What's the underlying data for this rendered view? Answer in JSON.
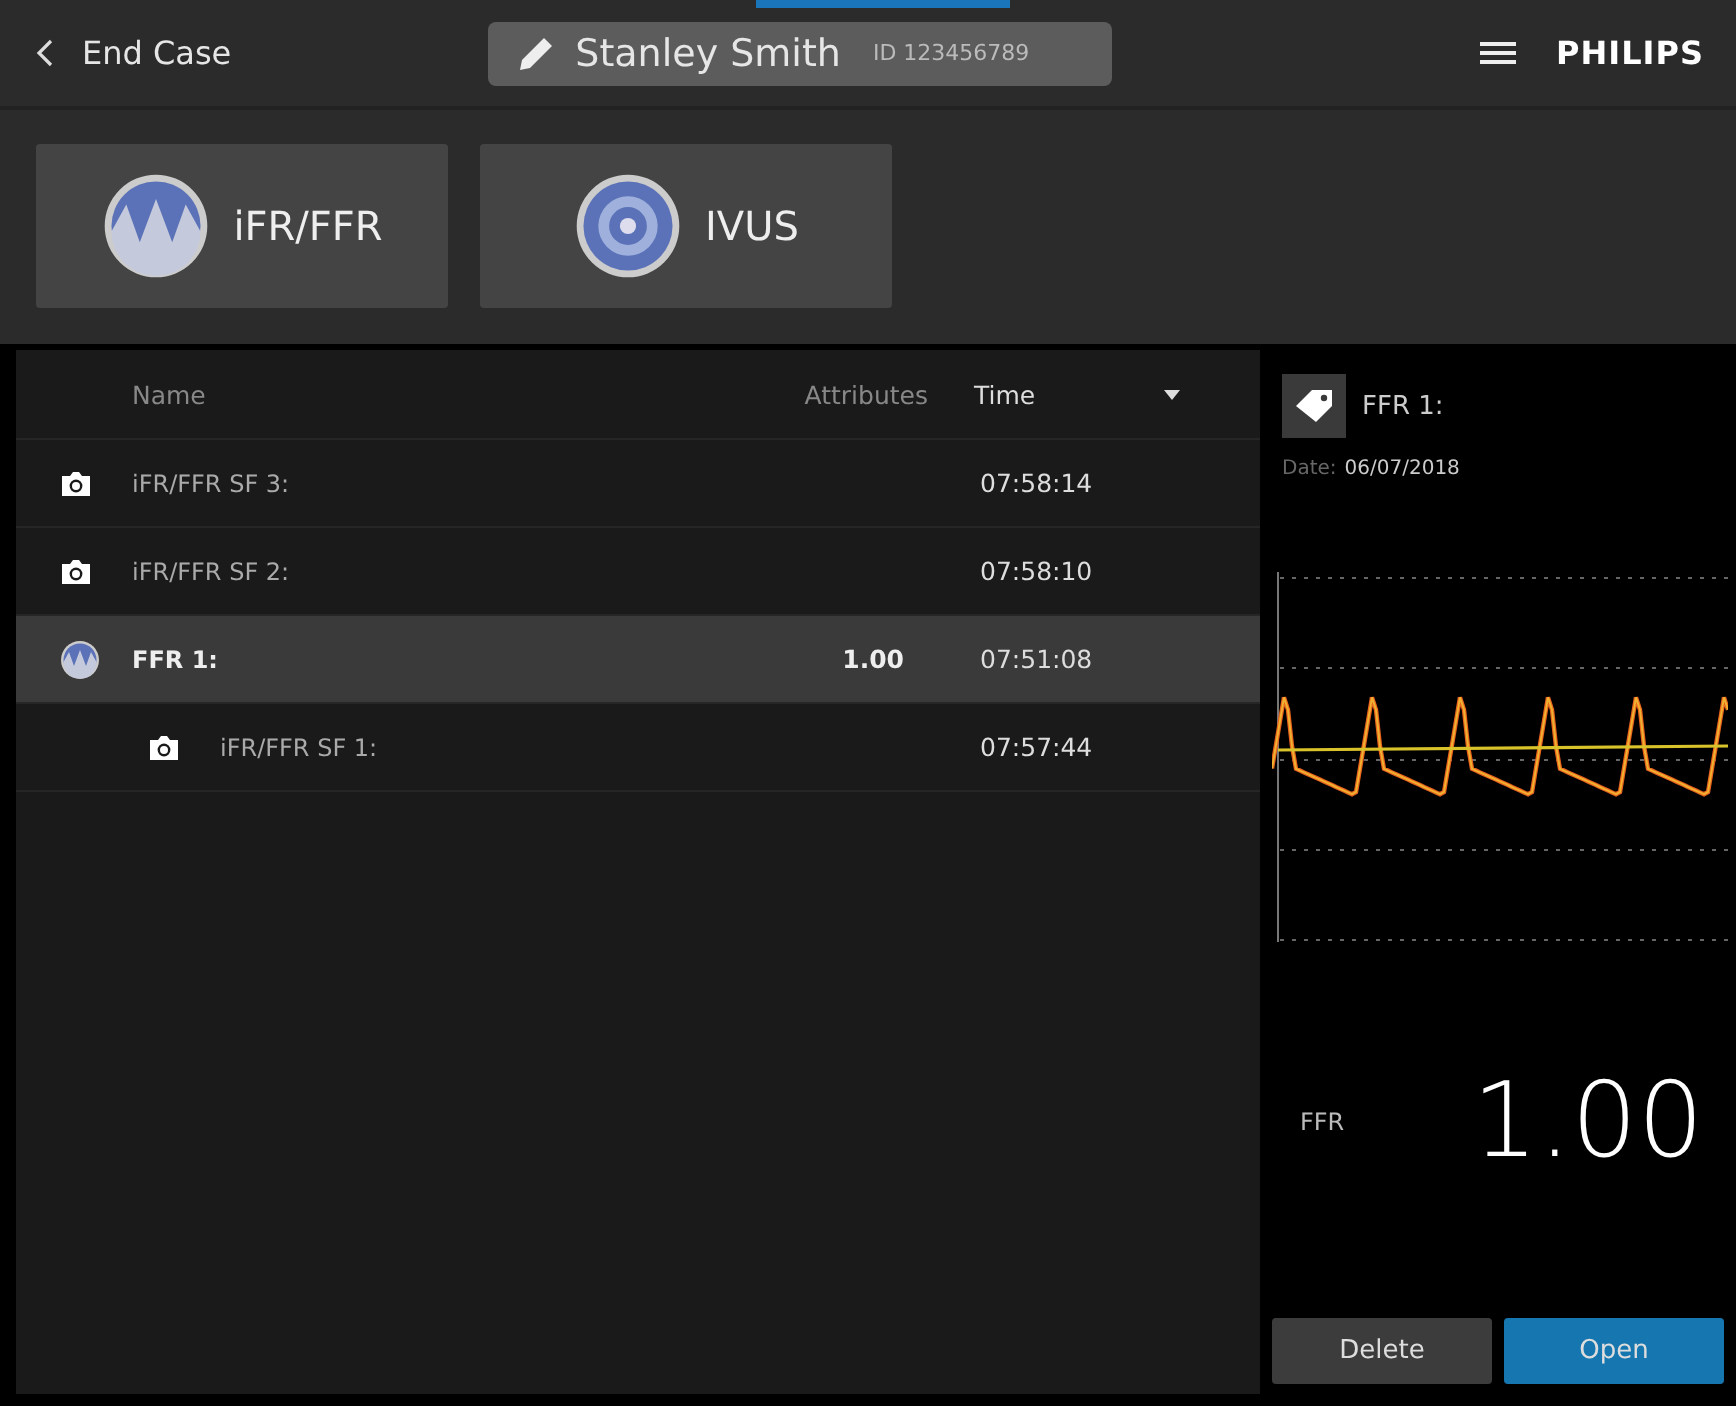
{
  "header": {
    "back_label": "End Case",
    "patient_name": "Stanley Smith",
    "id_label": "ID",
    "patient_id": "123456789",
    "brand": "PHILIPS"
  },
  "modes": [
    {
      "kind": "wave",
      "label": "iFR/FFR"
    },
    {
      "kind": "target",
      "label": "IVUS"
    }
  ],
  "table": {
    "columns": [
      "Name",
      "Attributes",
      "Time"
    ],
    "rows": [
      {
        "kind": "snapshot",
        "name": "iFR/FFR SF 3:",
        "time": "07:58:14",
        "selected": false
      },
      {
        "kind": "snapshot",
        "name": "iFR/FFR SF 2:",
        "time": "07:58:10",
        "selected": false
      },
      {
        "kind": "ffr",
        "name": "FFR 1:",
        "attribute": "1.00",
        "time": "07:51:08",
        "selected": true,
        "children": [
          {
            "kind": "snapshot",
            "name": "iFR/FFR SF 1:",
            "time": "07:57:44",
            "selected": false
          }
        ]
      }
    ]
  },
  "detail": {
    "title": "FFR 1:",
    "date_label": "Date:",
    "date": "06/07/2018",
    "measure_label": "FFR",
    "measure_value": "1.00",
    "buttons": [
      "Delete",
      "Open"
    ]
  }
}
